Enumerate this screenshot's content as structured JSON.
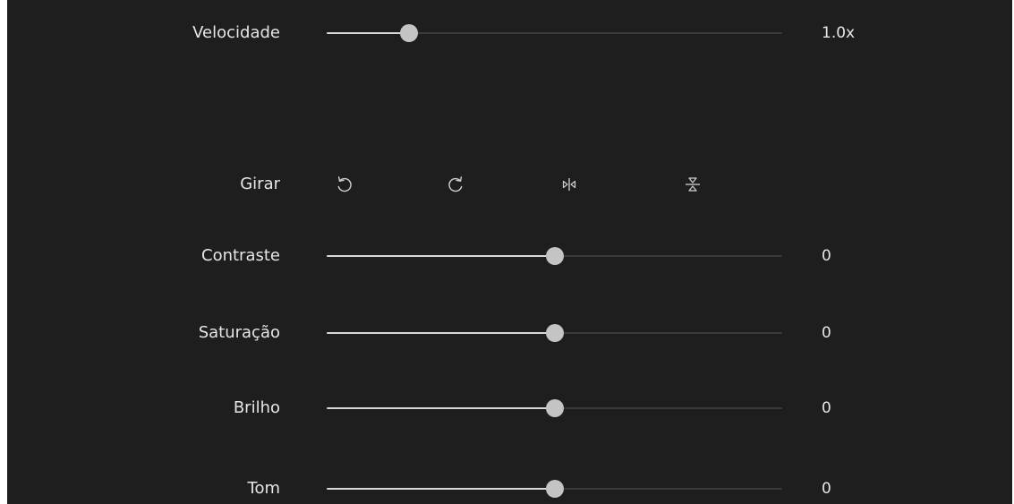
{
  "speed": {
    "label": "Velocidade",
    "value_text": "1.0x",
    "level": 0.18
  },
  "rotate": {
    "label": "Girar",
    "icons": [
      "rotate-left-icon",
      "rotate-right-icon",
      "flip-horizontal-icon",
      "flip-vertical-icon"
    ]
  },
  "contrast": {
    "label": "Contraste",
    "value_text": "0",
    "level": 0.5
  },
  "saturation": {
    "label": "Saturação",
    "value_text": "0",
    "level": 0.5
  },
  "brightness": {
    "label": "Brilho",
    "value_text": "0",
    "level": 0.5
  },
  "hue": {
    "label": "Tom",
    "value_text": "0",
    "level": 0.5
  },
  "colors": {
    "panel_bg": "#1e1e1e",
    "track": "#3a3a3a",
    "fill": "#d8d8d8",
    "thumb": "#c4c4c4",
    "text": "#e6e6e6"
  }
}
